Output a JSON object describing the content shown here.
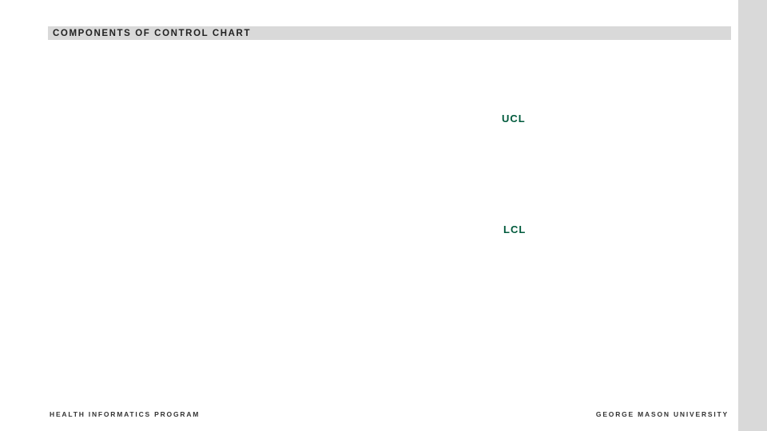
{
  "header": {
    "title": "COMPONENTS OF CONTROL CHART"
  },
  "labels": {
    "ucl": "UCL",
    "lcl": "LCL"
  },
  "footer": {
    "left": "HEALTH INFORMATICS PROGRAM",
    "right": "GEORGE MASON UNIVERSITY"
  }
}
